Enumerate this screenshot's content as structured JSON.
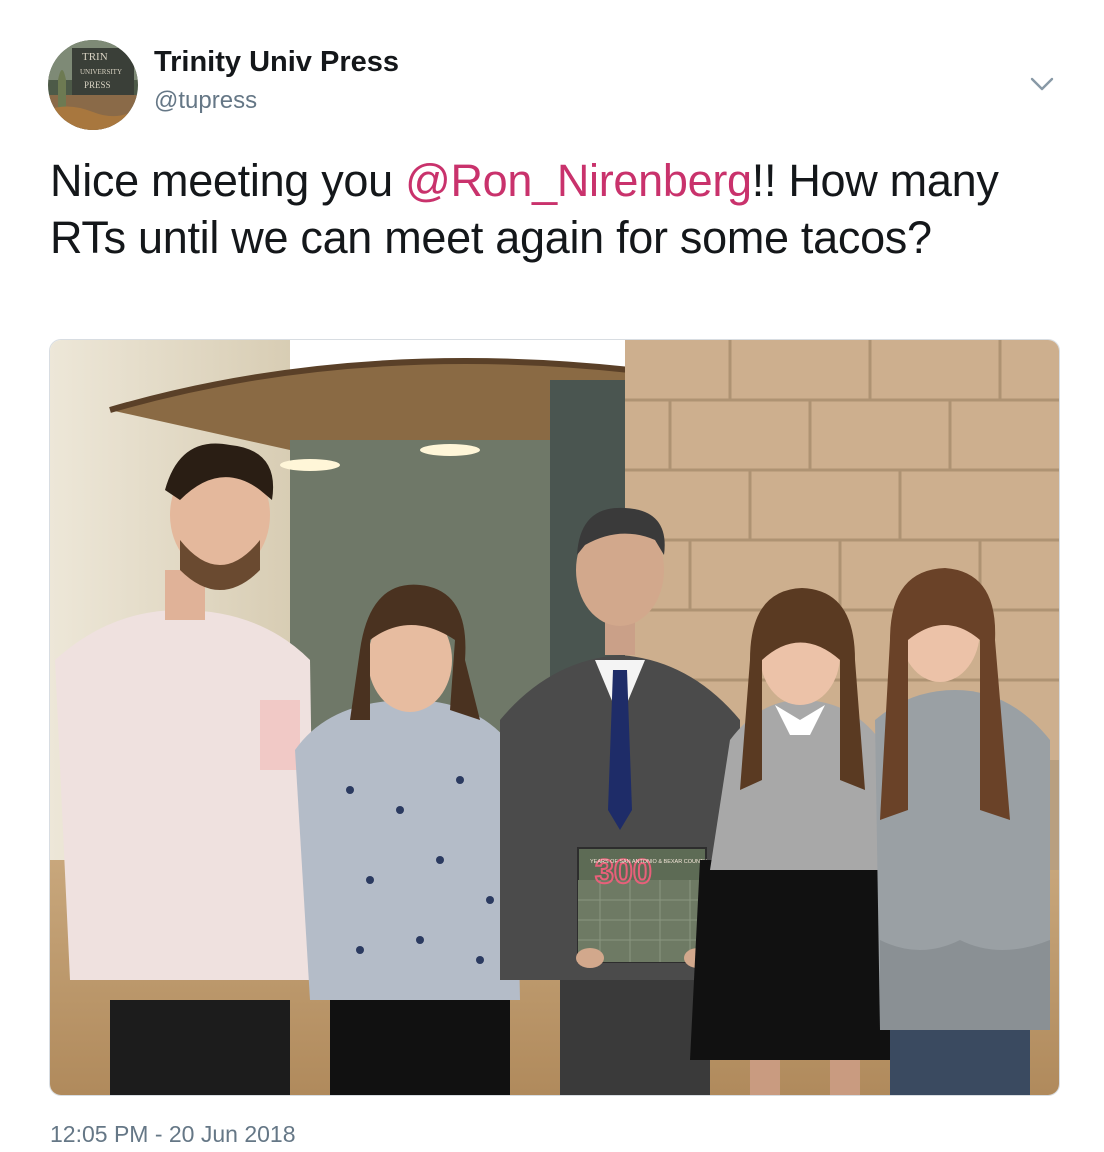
{
  "author": {
    "display_name": "Trinity Univ Press",
    "handle": "@tupress",
    "avatar_text": [
      "TRIN",
      "UNIVERSITY",
      "PRESS"
    ]
  },
  "tweet": {
    "text_before": "Nice meeting you ",
    "mention": "@Ron_Nirenberg",
    "text_after": "!! How many RTs until we can meet again for some tacos?",
    "timestamp": "12:05 PM - 20 Jun 2018"
  },
  "photo": {
    "book_title": "300",
    "book_subtitle": "YEARS OF SAN ANTONIO & BEXAR COUNTY"
  },
  "colors": {
    "mention": "#c9326c",
    "muted": "#657786",
    "text": "#14171a"
  },
  "icons": {
    "menu": "chevron-down-icon"
  }
}
